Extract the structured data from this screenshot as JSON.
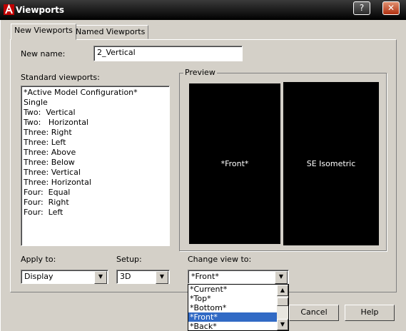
{
  "window": {
    "title": "Viewports",
    "controls": {
      "help": "?",
      "close": "✕"
    }
  },
  "tabs": [
    {
      "label": "New Viewports",
      "active": true
    },
    {
      "label": "Named Viewports",
      "active": false
    }
  ],
  "new_name": {
    "label": "New name:",
    "value": "2_Vertical"
  },
  "standard_viewports": {
    "label": "Standard viewports:",
    "items": [
      "*Active Model Configuration*",
      "Single",
      "Two:  Vertical",
      "Two:   Horizontal",
      "Three: Right",
      "Three: Left",
      "Three: Above",
      "Three: Below",
      "Three: Vertical",
      "Three: Horizontal",
      "Four:  Equal",
      "Four:  Right",
      "Four:  Left"
    ]
  },
  "preview": {
    "label": "Preview",
    "left_view": "*Front*",
    "right_view": "SE Isometric"
  },
  "apply_to": {
    "label": "Apply to:",
    "value": "Display"
  },
  "setup": {
    "label": "Setup:",
    "value": "3D"
  },
  "change_view": {
    "label": "Change view to:",
    "value": "*Front*",
    "options": [
      "*Current*",
      "*Top*",
      "*Bottom*",
      "*Front*",
      "*Back*"
    ],
    "selected_index": 3
  },
  "buttons": {
    "cancel": "Cancel",
    "help": "Help"
  },
  "colors": {
    "selection": "#316ac5",
    "preview_bg": "#000000",
    "dialog_bg": "#d4d0c8"
  }
}
